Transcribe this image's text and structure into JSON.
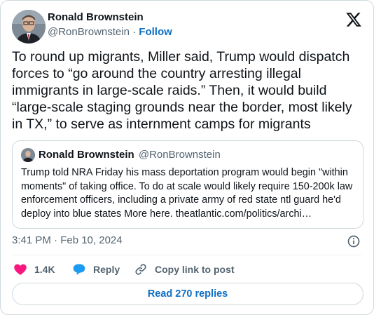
{
  "author": {
    "name": "Ronald Brownstein",
    "handle": "@RonBrownstein",
    "separator": "·",
    "follow_label": "Follow"
  },
  "tweet": {
    "text": "To round up migrants, Miller said, Trump would dispatch forces to “go around the country arresting illegal immigrants in large-scale raids.” Then, it would build “large-scale staging grounds near the border, most likely in TX,” to serve as internment camps for migrants",
    "timestamp": "3:41 PM · Feb 10, 2024"
  },
  "quoted_tweet": {
    "name": "Ronald Brownstein",
    "handle": "@RonBrownstein",
    "text": "Trump told NRA Friday his mass deportation program would begin \"within moments\" of taking office. To do at scale would likely require 150-200k law enforcement officers, including a private army of red state ntl guard he'd deploy into blue states More here. theatlantic.com/politics/archi…"
  },
  "actions": {
    "like_count": "1.4K",
    "reply_label": "Reply",
    "copy_link_label": "Copy link to post"
  },
  "read_replies_label": "Read 270 replies",
  "colors": {
    "like": "#f91880",
    "reply": "#1d9bf0",
    "link": "#0f6ec3",
    "secondary_text": "#536471",
    "border": "#cfd9de"
  },
  "icons": [
    "x-logo-icon",
    "heart-icon",
    "reply-bubble-icon",
    "link-icon",
    "info-icon"
  ]
}
